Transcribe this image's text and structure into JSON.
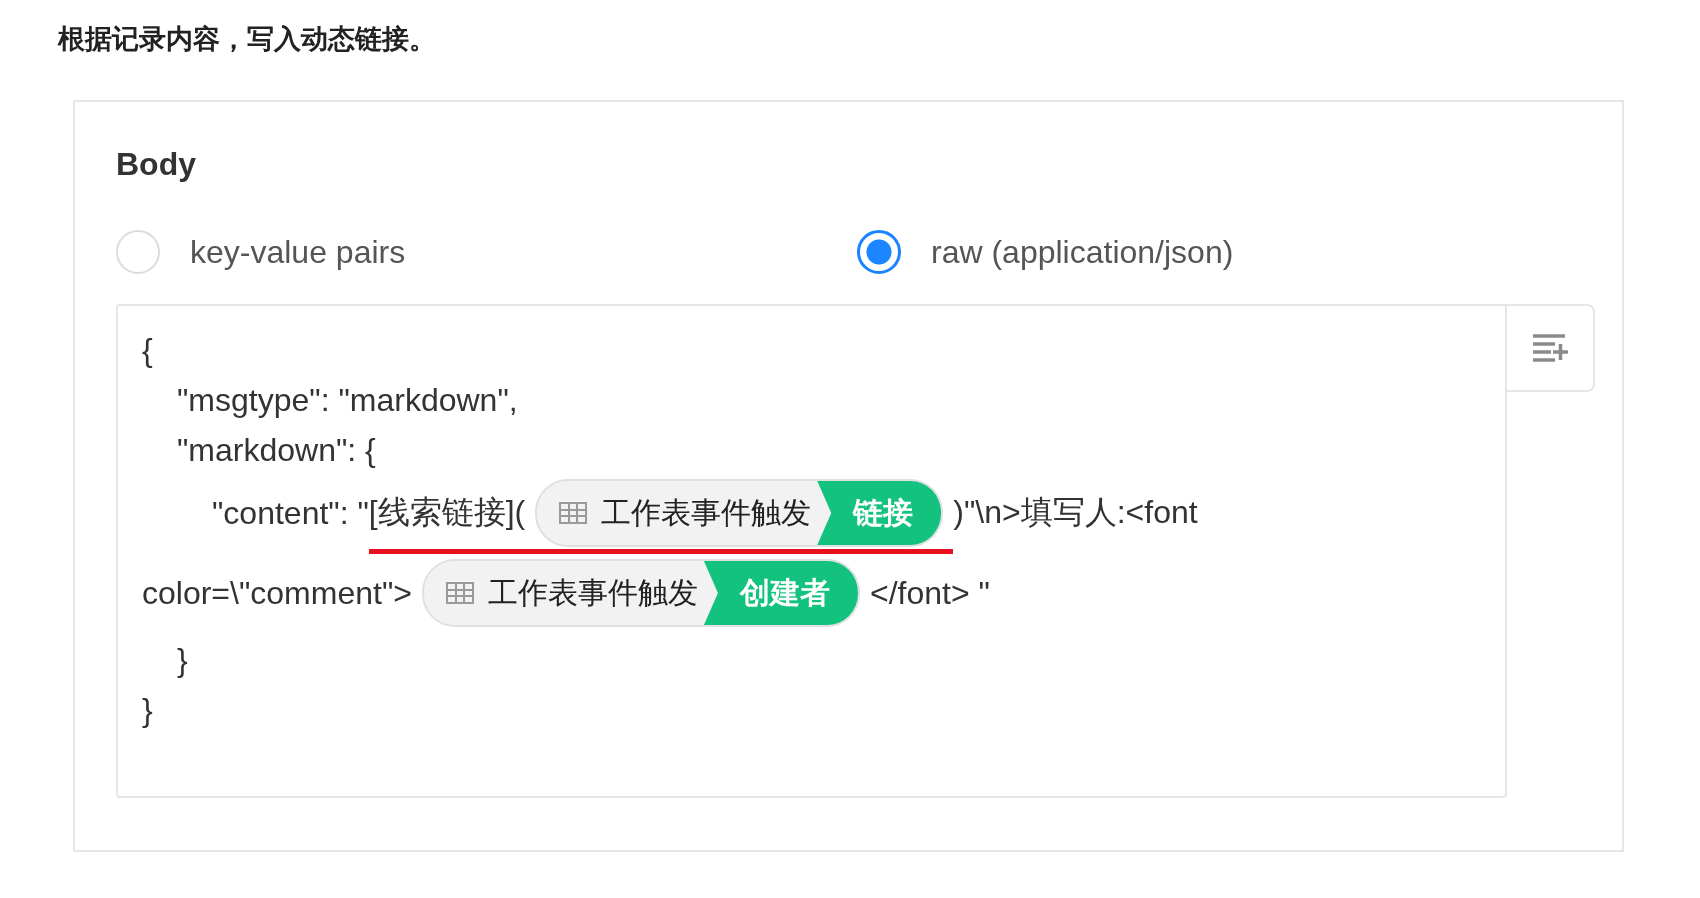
{
  "intro": "根据记录内容，写入动态链接。",
  "section_title": "Body",
  "body_modes": [
    {
      "label": "key-value pairs",
      "selected": false
    },
    {
      "label": "raw (application/json)",
      "selected": true
    }
  ],
  "editor": {
    "lines": [
      {
        "kind": "outer",
        "segments": [
          {
            "kind": "text",
            "text": "{"
          }
        ]
      },
      {
        "kind": "inner",
        "segments": [
          {
            "kind": "text",
            "text": "\"msgtype\": \"markdown\","
          }
        ]
      },
      {
        "kind": "inner",
        "segments": [
          {
            "kind": "text",
            "text": "\"markdown\": {"
          }
        ]
      },
      {
        "kind": "deep",
        "segments": [
          {
            "kind": "text",
            "text": "\"content\": \""
          },
          {
            "kind": "text",
            "text": "[线索链接](",
            "underlined": true
          },
          {
            "kind": "token",
            "source": "工作表事件触发",
            "field": "链接",
            "underlined": true
          },
          {
            "kind": "text",
            "text": ")\"\\n>填写人:<font"
          }
        ]
      },
      {
        "kind": "outer",
        "segments": [
          {
            "kind": "text",
            "text": "color=\\\"comment\">"
          },
          {
            "kind": "token",
            "source": "工作表事件触发",
            "field": "创建者"
          },
          {
            "kind": "text",
            "text": "</font> \""
          }
        ]
      },
      {
        "kind": "inner",
        "segments": [
          {
            "kind": "text",
            "text": "}"
          }
        ]
      },
      {
        "kind": "outer",
        "segments": [
          {
            "kind": "text",
            "text": "}"
          }
        ]
      }
    ]
  }
}
